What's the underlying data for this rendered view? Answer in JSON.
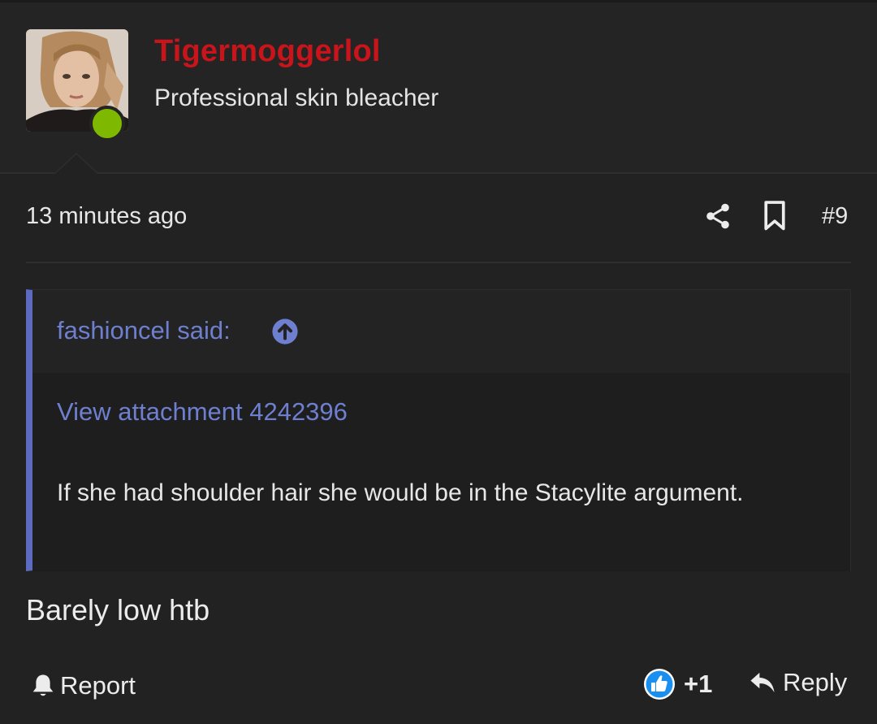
{
  "user": {
    "username": "Tigermoggerlol",
    "title": "Professional skin bleacher",
    "online": true,
    "name_color": "#c8141a",
    "online_color": "#7fb800"
  },
  "post": {
    "timestamp": "13 minutes ago",
    "number": "#9",
    "body": "Barely low htb"
  },
  "quote": {
    "author_label": "fashioncel said:",
    "attachment_label": "View attachment 4242396",
    "text": "If she had shoulder hair she would be in the Stacylite argument.",
    "accent_color": "#5c6bc0"
  },
  "actions": {
    "report_label": "Report",
    "reaction_count": "+1",
    "reply_label": "Reply"
  },
  "icons": {
    "share": "share-icon",
    "bookmark": "bookmark-icon",
    "quote_arrow": "arrow-up-circle-icon",
    "report": "bell-icon",
    "like": "thumbs-up-icon",
    "reply": "reply-arrow-icon"
  }
}
